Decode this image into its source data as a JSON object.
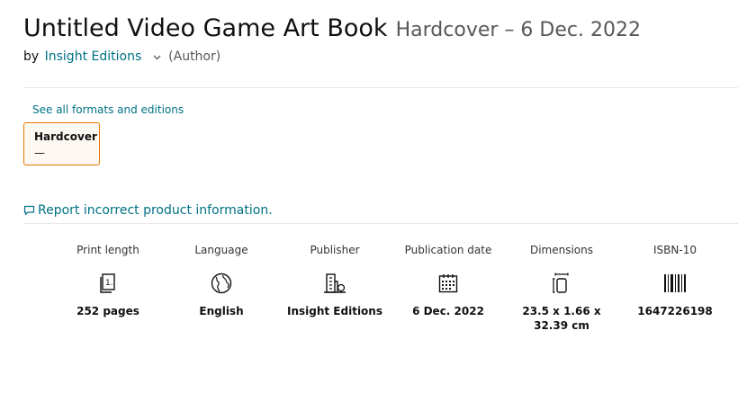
{
  "product": {
    "title": "Untitled Video Game Art Book",
    "binding_date": "Hardcover – 6 Dec. 2022"
  },
  "byline": {
    "prefix": "by",
    "author": "Insight Editions",
    "role": "(Author)"
  },
  "formats": {
    "see_all_label": "See all formats and editions",
    "selected": {
      "name": "Hardcover",
      "price": "—"
    }
  },
  "report_label": "Report incorrect product information.",
  "details": [
    {
      "label": "Print length",
      "value": "252 pages",
      "icon": "book-page-icon"
    },
    {
      "label": "Language",
      "value": "English",
      "icon": "globe-icon"
    },
    {
      "label": "Publisher",
      "value": "Insight Editions",
      "icon": "building-icon"
    },
    {
      "label": "Publication date",
      "value": "6 Dec. 2022",
      "icon": "calendar-icon"
    },
    {
      "label": "Dimensions",
      "value": "23.5 x 1.66 x 32.39 cm",
      "icon": "dimensions-icon"
    },
    {
      "label": "ISBN-10",
      "value": "1647226198",
      "icon": "barcode-icon"
    }
  ],
  "colors": {
    "link": "#007185",
    "accent": "#e77600",
    "text": "#0f1111",
    "muted": "#565959"
  }
}
